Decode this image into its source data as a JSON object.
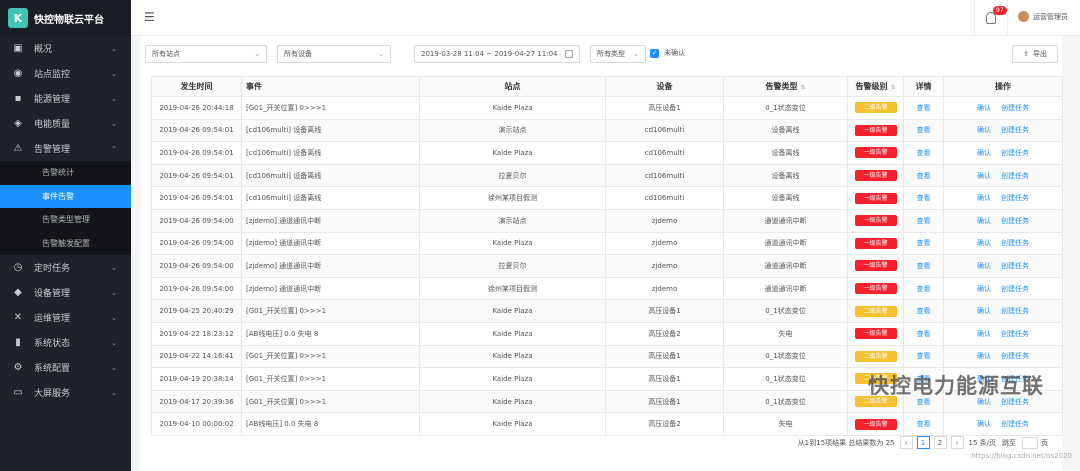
{
  "brand": {
    "logo_text": "K",
    "title": "快控物联云平台"
  },
  "menu": [
    {
      "icon": "monitor-icon",
      "glyph": "▣",
      "label": "概况",
      "caret": "⌄"
    },
    {
      "icon": "dashboard-icon",
      "glyph": "◉",
      "label": "站点监控",
      "caret": "⌄"
    },
    {
      "icon": "energy-icon",
      "glyph": "▪",
      "label": "能源管理",
      "caret": "⌄"
    },
    {
      "icon": "power-quality-icon",
      "glyph": "◈",
      "label": "电能质量",
      "caret": "⌄"
    },
    {
      "icon": "alarm-icon",
      "glyph": "⚠",
      "label": "告警管理",
      "caret": "⌃"
    }
  ],
  "submenu": [
    "告警统计",
    "事件告警",
    "告警类型管理",
    "告警触发配置"
  ],
  "menu2": [
    {
      "icon": "timer-icon",
      "glyph": "◷",
      "label": "定时任务",
      "caret": "⌄"
    },
    {
      "icon": "device-icon",
      "glyph": "◆",
      "label": "设备管理",
      "caret": "⌄"
    },
    {
      "icon": "tools-icon",
      "glyph": "✕",
      "label": "运维管理",
      "caret": "⌄"
    },
    {
      "icon": "chart-icon",
      "glyph": "▮",
      "label": "系统状态",
      "caret": "⌄"
    },
    {
      "icon": "gear-icon",
      "glyph": "⚙",
      "label": "系统配置",
      "caret": "⌄"
    },
    {
      "icon": "screen-icon",
      "glyph": "▭",
      "label": "大屏服务",
      "caret": "⌄"
    }
  ],
  "topbar": {
    "badge_count": "97",
    "user_name": "运营管理员"
  },
  "filters": {
    "site": "所有站点",
    "device": "所有设备",
    "date_range": "2019-03-28 11:04 ~ 2019-04-27 11:04",
    "type": "所有类型",
    "unconfirmed": "未确认",
    "export": "导出"
  },
  "table": {
    "headers": [
      "发生时间",
      "事件",
      "站点",
      "设备",
      "告警类型",
      "告警级别",
      "详情",
      "操作"
    ],
    "detail_label": "查看",
    "confirm_label": "确认",
    "task_label": "创建任务",
    "level_colors": {
      "二级告警": "#f5c131",
      "一级告警": "#f5222d"
    },
    "rows": [
      {
        "time": "2019-04-26 20:44:18",
        "event": "[G01_开关位置] 0>>>1",
        "site": "Kaide Plaza",
        "device": "高压设备1",
        "type": "0_1状态变位",
        "level": "二级告警"
      },
      {
        "time": "2019-04-26 09:54:01",
        "event": "[cd106multi] 设备离线",
        "site": "演示站点",
        "device": "cd106multi",
        "type": "设备离线",
        "level": "一级告警"
      },
      {
        "time": "2019-04-26 09:54:01",
        "event": "[cd106multi] 设备离线",
        "site": "Kaide Plaza",
        "device": "cd106multi",
        "type": "设备离线",
        "level": "一级告警"
      },
      {
        "time": "2019-04-26 09:54:01",
        "event": "[cd106multi] 设备离线",
        "site": "拉夏贝尔",
        "device": "cd106multi",
        "type": "设备离线",
        "level": "一级告警"
      },
      {
        "time": "2019-04-26 09:54:01",
        "event": "[cd106multi] 设备离线",
        "site": "徐州某项目假测",
        "device": "cd106multi",
        "type": "设备离线",
        "level": "一级告警"
      },
      {
        "time": "2019-04-26 09:54:00",
        "event": "[zjdemo] 通道通讯中断",
        "site": "演示站点",
        "device": "zjdemo",
        "type": "通道通讯中断",
        "level": "一级告警"
      },
      {
        "time": "2019-04-26 09:54:00",
        "event": "[zjdemo] 通道通讯中断",
        "site": "Kaide Plaza",
        "device": "zjdemo",
        "type": "通道通讯中断",
        "level": "一级告警"
      },
      {
        "time": "2019-04-26 09:54:00",
        "event": "[zjdemo] 通道通讯中断",
        "site": "拉夏贝尔",
        "device": "zjdemo",
        "type": "通道通讯中断",
        "level": "一级告警"
      },
      {
        "time": "2019-04-26 09:54:00",
        "event": "[zjdemo] 通道通讯中断",
        "site": "徐州某项目假测",
        "device": "zjdemo",
        "type": "通道通讯中断",
        "level": "一级告警"
      },
      {
        "time": "2019-04-25 20:40:29",
        "event": "[G01_开关位置] 0>>>1",
        "site": "Kaide Plaza",
        "device": "高压设备1",
        "type": "0_1状态变位",
        "level": "二级告警"
      },
      {
        "time": "2019-04-22 18:23:12",
        "event": "[AB线电压] 0.0 失电 8",
        "site": "Kaide Plaza",
        "device": "高压设备2",
        "type": "失电",
        "level": "一级告警"
      },
      {
        "time": "2019-04-22 14:16:41",
        "event": "[G01_开关位置] 0>>>1",
        "site": "Kaide Plaza",
        "device": "高压设备1",
        "type": "0_1状态变位",
        "level": "二级告警"
      },
      {
        "time": "2019-04-19 20:38:14",
        "event": "[G01_开关位置] 0>>>1",
        "site": "Kaide Plaza",
        "device": "高压设备1",
        "type": "0_1状态变位",
        "level": "二级告警"
      },
      {
        "time": "2019-04-17 20:39:36",
        "event": "[G01_开关位置] 0>>>1",
        "site": "Kaide Plaza",
        "device": "高压设备1",
        "type": "0_1状态变位",
        "level": "二级告警"
      },
      {
        "time": "2019-04-10 00:00:02",
        "event": "[AB线电压] 0.0 失电 8",
        "site": "Kaide Plaza",
        "device": "高压设备2",
        "type": "失电",
        "level": "一级告警"
      }
    ]
  },
  "pagination": {
    "summary": "从1到15项结果 总结果数为 25",
    "prev": "‹",
    "pages": [
      "1",
      "2"
    ],
    "next": "›",
    "page_size": "15 条/页",
    "jump_label": "跳至",
    "page_unit": "页"
  },
  "watermark": {
    "text": "快控电力能源互联",
    "url": "https://blog.csdn.net/ns2020"
  }
}
